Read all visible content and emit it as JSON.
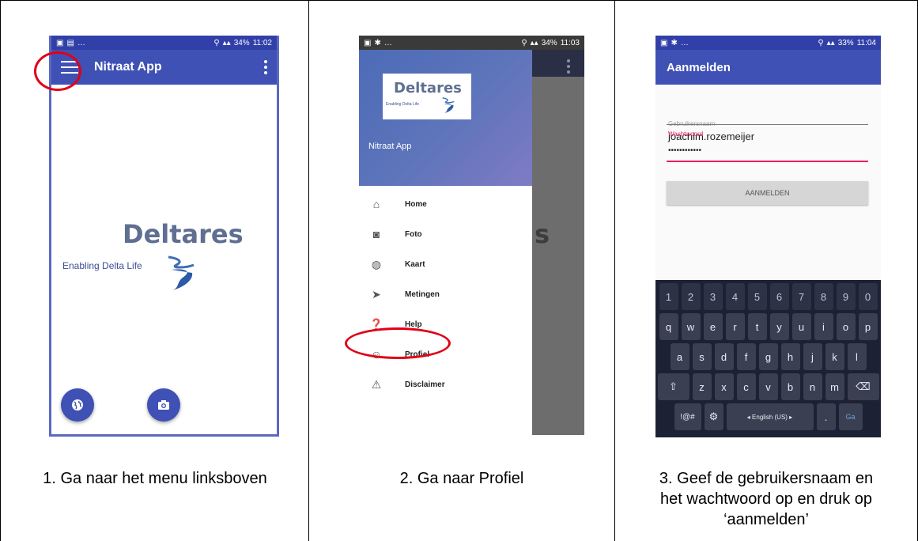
{
  "panel1": {
    "status_time": "11:02",
    "status_battery": "34%",
    "app_title": "Nitraat App",
    "logo_word": "Deltares",
    "logo_tag": "Enabling Delta Life",
    "caption": "1. Ga naar het menu linksboven"
  },
  "panel2": {
    "status_time": "11:03",
    "status_battery": "34%",
    "logo_word": "Deltares",
    "logo_tag": "Enabling Delta Life",
    "app_name": "Nitraat App",
    "menu": [
      {
        "label": "Home",
        "icon": "home-icon"
      },
      {
        "label": "Foto",
        "icon": "camera-icon"
      },
      {
        "label": "Kaart",
        "icon": "globe-icon"
      },
      {
        "label": "Metingen",
        "icon": "send-icon"
      },
      {
        "label": "Help",
        "icon": "help-icon"
      },
      {
        "label": "Profiel",
        "icon": "account-icon"
      },
      {
        "label": "Disclaimer",
        "icon": "warning-icon"
      }
    ],
    "bg_partial_text": "s",
    "caption": "2. Ga naar Profiel"
  },
  "panel3": {
    "status_time": "11:04",
    "status_battery": "33%",
    "title": "Aanmelden",
    "username_label": "Gebruikersnaam",
    "username_value": "joachim.rozemeijer",
    "password_label": "Wachtwoord",
    "password_value": "••••••••••••",
    "login_button": "AANMELDEN",
    "keyboard": {
      "numbers": [
        "1",
        "2",
        "3",
        "4",
        "5",
        "6",
        "7",
        "8",
        "9",
        "0"
      ],
      "row1": [
        "q",
        "w",
        "e",
        "r",
        "t",
        "y",
        "u",
        "i",
        "o",
        "p"
      ],
      "row2": [
        "a",
        "s",
        "d",
        "f",
        "g",
        "h",
        "j",
        "k",
        "l"
      ],
      "row3": [
        "z",
        "x",
        "c",
        "v",
        "b",
        "n",
        "m"
      ],
      "sym_key": "!@#",
      "space_label": "◂ English (US) ▸",
      "period_key": ".",
      "go_key": "Ga"
    },
    "caption_line1": "3. Geef de gebruikersnaam en",
    "caption_line2": "het wachtwoord op en druk op",
    "caption_line3": "‘aanmelden’"
  },
  "colors": {
    "primary": "#3f51b5",
    "status": "#3140a8",
    "highlight_ring": "#e10015",
    "password_underline": "#e91e63"
  }
}
